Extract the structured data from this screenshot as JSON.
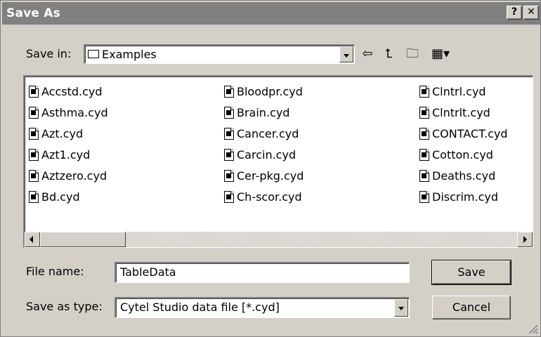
{
  "window": {
    "title": "Save As",
    "help_label": "?",
    "close_label": "✕"
  },
  "save_in": {
    "label": "Save in:",
    "folder": "Examples"
  },
  "toolbar": {
    "back_icon": "⇦",
    "up_icon": "⮤",
    "new_folder_icon": "🗀",
    "view_icon": "▦▾"
  },
  "files": {
    "col1": [
      "Accstd.cyd",
      "Asthma.cyd",
      "Azt.cyd",
      "Azt1.cyd",
      "Aztzero.cyd",
      "Bd.cyd"
    ],
    "col2": [
      "Bloodpr.cyd",
      "Brain.cyd",
      "Cancer.cyd",
      "Carcin.cyd",
      "Cer-pkg.cyd",
      "Ch-scor.cyd"
    ],
    "col3": [
      "Clntrl.cyd",
      "Clntrlt.cyd",
      "CONTACT.cyd",
      "Cotton.cyd",
      "Deaths.cyd",
      "Discrim.cyd"
    ]
  },
  "filename": {
    "label": "File name:",
    "value": "TableData"
  },
  "filetype": {
    "label": "Save as type:",
    "value": "Cytel Studio data file [*.cyd]"
  },
  "buttons": {
    "save": "Save",
    "cancel": "Cancel"
  }
}
